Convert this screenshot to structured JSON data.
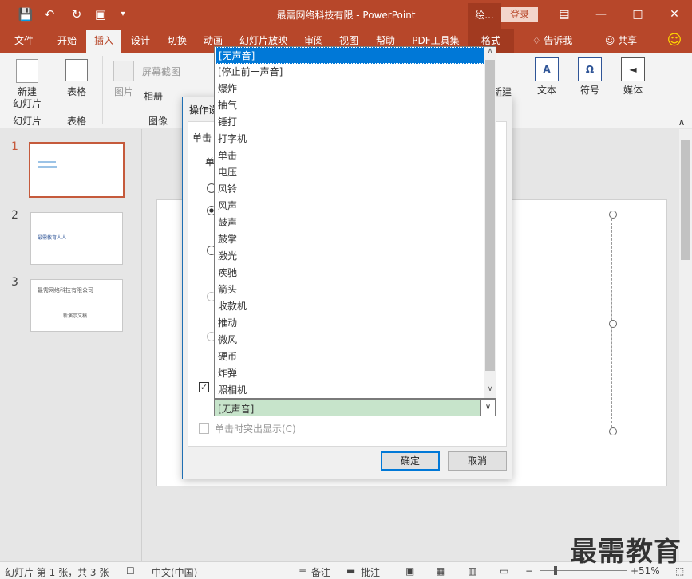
{
  "title": "最需网络科技有限 - PowerPoint",
  "context_tab": "绘...",
  "login": "登录",
  "tabs": [
    "文件",
    "开始",
    "插入",
    "设计",
    "切换",
    "动画",
    "幻灯片放映",
    "审阅",
    "视图",
    "帮助",
    "PDF工具集",
    "格式"
  ],
  "tell_me": "告诉我",
  "share": "共享",
  "ribbon": {
    "new_slide": "新建",
    "new_slide2": "幻灯片",
    "group_slides": "幻灯片",
    "table": "表格",
    "group_tables": "表格",
    "picture": "图片",
    "screenshot": "屏幕截图",
    "album": "相册",
    "group_images": "图像",
    "new_right": "新建",
    "text": "文本",
    "symbol": "符号",
    "media": "媒体"
  },
  "thumbs": [
    {
      "num": "1",
      "text": ""
    },
    {
      "num": "2",
      "text": "最需教育人人"
    },
    {
      "num": "3",
      "text": "最需网络科技有限公司",
      "sub": "新演示文稿"
    }
  ],
  "dialog": {
    "title": "操作设",
    "tab": "单击",
    "group": "单",
    "highlight_label": "单击时突出显示(C)",
    "ok": "确定",
    "cancel": "取消"
  },
  "sound_options": [
    "[无声音]",
    "[停止前一声音]",
    "爆炸",
    "抽气",
    "锤打",
    "打字机",
    "单击",
    "电压",
    "风铃",
    "风声",
    "鼓声",
    "鼓掌",
    "激光",
    "疾驰",
    "箭头",
    "收款机",
    "推动",
    "微风",
    "硬币",
    "炸弹",
    "照相机"
  ],
  "sound_selected": "[无声音]",
  "status": {
    "slide_info": "幻灯片 第 1 张，共 3 张",
    "language": "中文(中国)",
    "notes": "备注",
    "comments": "批注",
    "zoom": "51%"
  },
  "watermark": "最需教育"
}
